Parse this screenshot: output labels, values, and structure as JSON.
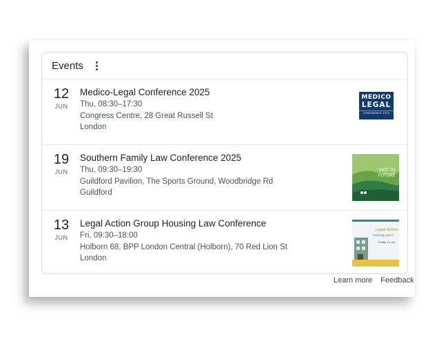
{
  "card": {
    "title": "Events",
    "menu_icon": "more-vertical-icon"
  },
  "events": [
    {
      "day": "12",
      "month": "JUN",
      "title": "Medico-Legal Conference 2025",
      "time": "Thu, 08:30–17:30",
      "venue": "Congress Centre, 28 Great Russell St",
      "city": "London",
      "thumbnail": {
        "logo_line1": "MEDICO",
        "logo_line2": "LEGAL",
        "logo_line3": "CONFERENCE 2025",
        "bg_color": "#123a6e"
      }
    },
    {
      "day": "19",
      "month": "JUN",
      "title": "Southern Family Law Conference 2025",
      "time": "Thu, 09:30–19:30",
      "venue": "Guildford Pavilion, The Sports Ground, Woodbridge Rd",
      "city": "Guildford",
      "thumbnail": {
        "text1": "\"HOT TO",
        "text2": "FUTURE",
        "bg_color": "#83b55a"
      }
    },
    {
      "day": "13",
      "month": "JUN",
      "title": "Legal Action Group Housing Law Conference",
      "time": "Fri, 09:30–18:00",
      "venue": "Holborn 68, BPP London Central (Holborn), 70 Red Lion St",
      "city": "London",
      "thumbnail": {
        "title": "Legal Action",
        "subtitle": "Housing Law C",
        "date": "Friday 13 Jun",
        "accent_color": "#e9c440"
      }
    }
  ],
  "footer": {
    "learn_more": "Learn more",
    "feedback": "Feedback"
  }
}
